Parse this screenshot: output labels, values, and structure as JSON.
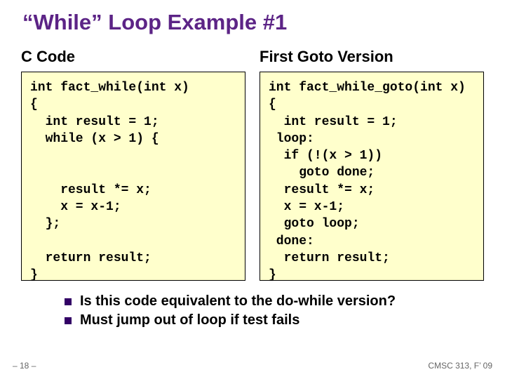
{
  "title": "“While” Loop Example #1",
  "left": {
    "heading": "C Code",
    "code": "int fact_while(int x)\n{\n  int result = 1;\n  while (x > 1) {\n\n\n    result *= x;\n    x = x-1;\n  };\n\n  return result;\n}"
  },
  "right": {
    "heading": "First Goto Version",
    "code": "int fact_while_goto(int x)\n{\n  int result = 1;\n loop:\n  if (!(x > 1))\n    goto done;\n  result *= x;\n  x = x-1;\n  goto loop;\n done:\n  return result;\n}"
  },
  "bullets": [
    "Is this code equivalent to the do-while version?",
    "Must jump out of loop if test fails"
  ],
  "footer": {
    "left": "– 18 –",
    "right": "CMSC 313, F’ 09"
  }
}
